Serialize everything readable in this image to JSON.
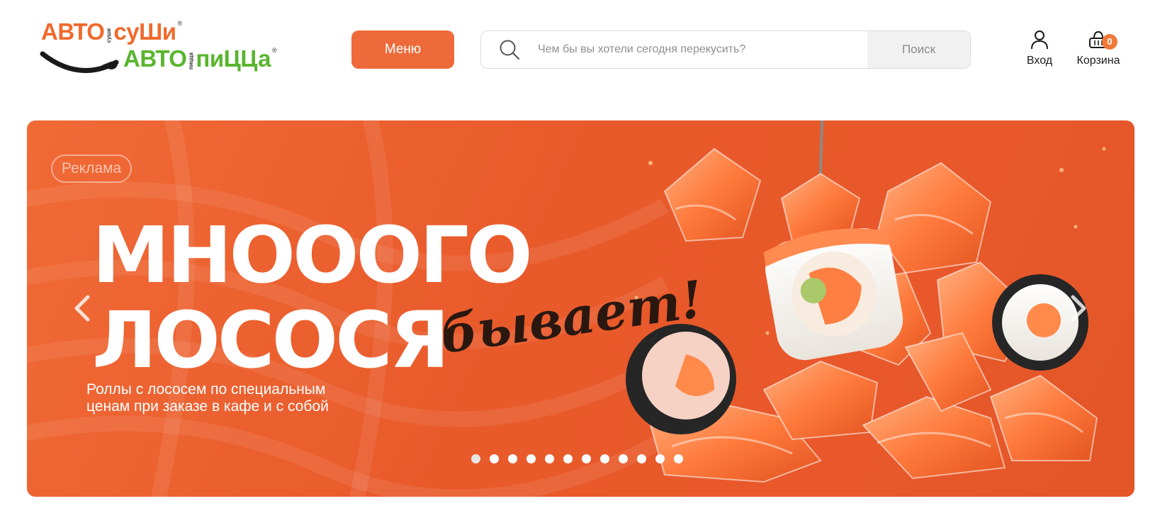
{
  "brand": {
    "line1_left": "АВТО",
    "line1_mini": "суши",
    "line1_right": "суШи",
    "line2_left": "АВТО",
    "line2_mini": "пицца",
    "line2_right": "пиЦЦа",
    "reg": "®"
  },
  "header": {
    "menu_label": "Меню",
    "search_placeholder": "Чем бы вы хотели сегодня перекусить?",
    "search_button": "Поиск",
    "login_label": "Вход",
    "cart_label": "Корзина",
    "cart_count": "0"
  },
  "banner": {
    "ad_label": "Реклама",
    "headline_line1": "МНОООГО",
    "headline_line2": "ЛОСОСЯ",
    "headline_script": "бывает!",
    "subtitle_line1": "Роллы с лососем по специальным",
    "subtitle_line2": "ценам при заказе в кафе и с собой",
    "slides_total": 12,
    "active_slide": 1
  },
  "colors": {
    "accent": "#ef6a3a",
    "banner_bg": "#e95a2b",
    "logo_orange": "#ef6a2e",
    "logo_green": "#59b52e"
  },
  "icons": [
    "search-icon",
    "user-icon",
    "basket-icon",
    "chevron-left-icon",
    "chevron-right-icon"
  ]
}
